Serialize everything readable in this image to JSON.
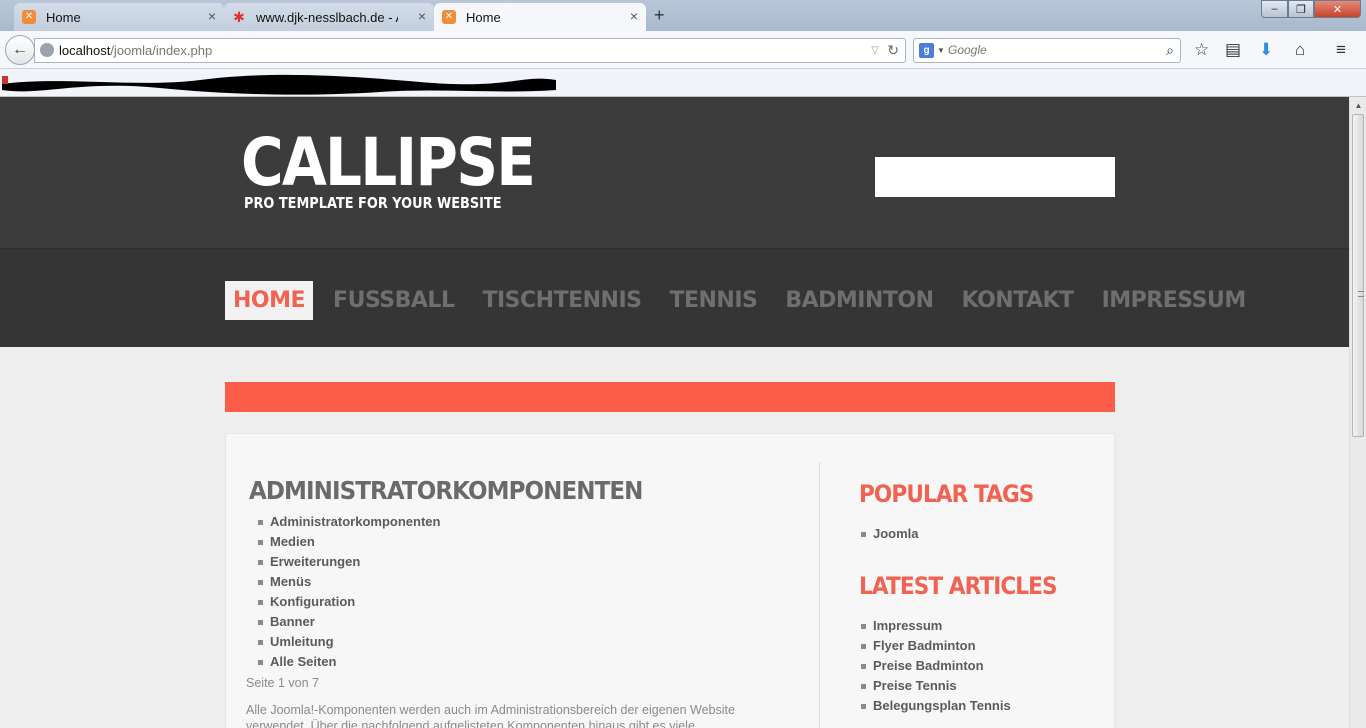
{
  "browser": {
    "tabs": [
      {
        "title": "Home",
        "active": false
      },
      {
        "title": "www.djk-nesslbach.de - A...",
        "active": false
      },
      {
        "title": "Home",
        "active": true
      }
    ],
    "new_tab": "+",
    "url_host": "localhost",
    "url_path": "/joomla/index.php",
    "search_placeholder": "Google",
    "window_controls": {
      "minimize": "‒",
      "maximize": "❐",
      "close": "✕"
    }
  },
  "site": {
    "logo": "CALLIPSE",
    "tagline": "PRO TEMPLATE FOR YOUR WEBSITE",
    "menu": [
      {
        "label": "HOME",
        "active": true
      },
      {
        "label": "FUSSBALL",
        "active": false
      },
      {
        "label": "TISCHTENNIS",
        "active": false
      },
      {
        "label": "TENNIS",
        "active": false
      },
      {
        "label": "BADMINTON",
        "active": false
      },
      {
        "label": "KONTAKT",
        "active": false
      },
      {
        "label": "IMPRESSUM",
        "active": false
      }
    ],
    "colors": {
      "accent": "#fb5d49",
      "header_bg": "#3c3c3c",
      "menu_bg": "#353535",
      "page_bg": "#eeeeee"
    }
  },
  "article": {
    "title": "ADMINISTRATORKOMPONENTEN",
    "links": [
      "Administratorkomponenten",
      "Medien",
      "Erweiterungen",
      "Menüs",
      "Konfiguration",
      "Banner",
      "Umleitung",
      "Alle Seiten"
    ],
    "pagecount": "Seite 1 von 7",
    "intro": "Alle Joomla!-Komponenten werden auch im Administrationsbereich der eigenen Website verwendet. Über die nachfolgend aufgelisteten Komponenten hinaus gibt es viele"
  },
  "sidebar": {
    "popular_tags_title": "POPULAR TAGS",
    "popular_tags": [
      "Joomla"
    ],
    "latest_articles_title": "LATEST ARTICLES",
    "latest_articles": [
      "Impressum",
      "Flyer Badminton",
      "Preise Badminton",
      "Preise Tennis",
      "Belegungsplan Tennis"
    ]
  }
}
